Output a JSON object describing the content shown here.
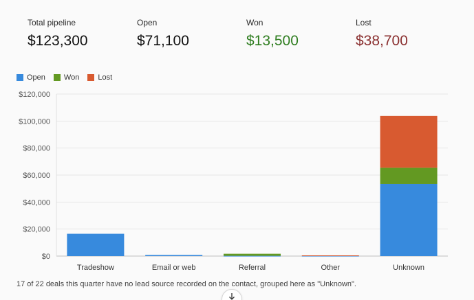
{
  "kpis": {
    "total": {
      "label": "Total pipeline",
      "value": "$123,300"
    },
    "open": {
      "label": "Open",
      "value": "$71,100"
    },
    "won": {
      "label": "Won",
      "value": "$13,500"
    },
    "lost": {
      "label": "Lost",
      "value": "$38,700"
    }
  },
  "colors": {
    "open": "#378ADD",
    "won": "#639922",
    "lost": "#D85A30",
    "won_text": "#2e7d1f",
    "lost_text": "#8a2f2f"
  },
  "legend": [
    {
      "name": "Open",
      "color_key": "open"
    },
    {
      "name": "Won",
      "color_key": "won"
    },
    {
      "name": "Lost",
      "color_key": "lost"
    }
  ],
  "chart_data": {
    "type": "bar",
    "stacked": true,
    "categories": [
      "Tradeshow",
      "Email or web",
      "Referral",
      "Other",
      "Unknown"
    ],
    "series": [
      {
        "name": "Open",
        "values": [
          16500,
          800,
          200,
          200,
          53400
        ]
      },
      {
        "name": "Won",
        "values": [
          0,
          0,
          1500,
          0,
          12000
        ]
      },
      {
        "name": "Lost",
        "values": [
          0,
          0,
          0,
          300,
          38400
        ]
      }
    ],
    "ylim": [
      0,
      120000
    ],
    "yticks": [
      "$0",
      "$20,000",
      "$40,000",
      "$60,000",
      "$80,000",
      "$100,000",
      "$120,000"
    ],
    "grid": true,
    "legend_position": "top-left"
  },
  "note": "17 of 22 deals this quarter have no lead source recorded on the contact, grouped here as \"Unknown\".",
  "scroll_button_icon": "arrow-down-icon"
}
